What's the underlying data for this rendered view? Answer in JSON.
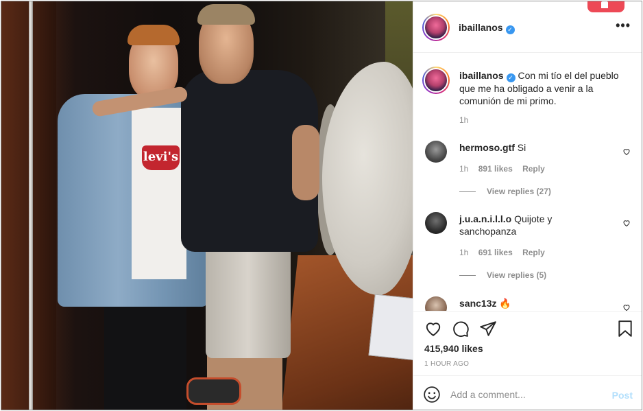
{
  "post": {
    "author": "ibaillanos",
    "verified": true
  },
  "photo": {
    "shirt_logo_text": "levi's"
  },
  "caption": {
    "username": "ibaillanos",
    "text": "Con mi tío el del pueblo que me ha obligado a venir a la comunión de mi primo.",
    "time": "1h"
  },
  "comments": [
    {
      "username": "hermoso.gtf",
      "text": "Si",
      "time": "1h",
      "likes": "891 likes",
      "reply_label": "Reply",
      "view_replies": "View replies (27)"
    },
    {
      "username": "j.u.a.n.i.l.l.o",
      "text": "Quijote y sanchopanza",
      "time": "1h",
      "likes": "691 likes",
      "reply_label": "Reply",
      "view_replies": "View replies (5)"
    },
    {
      "username": "sanc13z",
      "text": "🔥"
    }
  ],
  "actions": {
    "likes": "415,940 likes",
    "timestamp": "1 HOUR AGO"
  },
  "add_comment": {
    "placeholder": "Add a comment...",
    "post_label": "Post"
  },
  "colors": {
    "verified": "#3897f0",
    "notification": "#ed4956",
    "post_button_disabled": "#b2dffc",
    "secondary_text": "#8e8e8e"
  },
  "icons": [
    "more-icon",
    "heart-icon",
    "comment-icon",
    "share-icon",
    "save-icon",
    "emoji-icon",
    "verified-badge-icon"
  ]
}
